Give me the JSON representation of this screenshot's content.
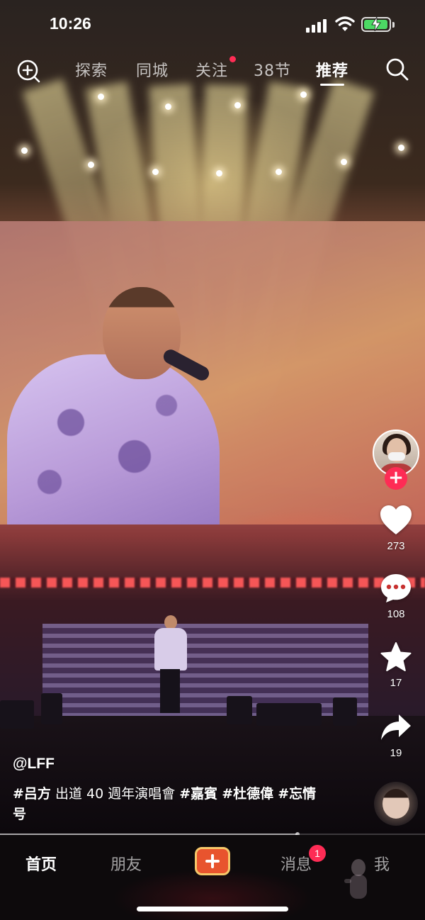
{
  "status_bar": {
    "time": "10:26",
    "battery_color": "#4cd964"
  },
  "top_nav": {
    "tabs": [
      {
        "label": "探索",
        "active": false
      },
      {
        "label": "同城",
        "active": false
      },
      {
        "label": "关注",
        "active": false,
        "has_red_dot": true
      },
      {
        "label": "38节",
        "active": false
      },
      {
        "label": "推荐",
        "active": true
      }
    ],
    "left_icon": "add-circle-search-icon",
    "right_icon": "search-icon"
  },
  "actions": {
    "like_count": "273",
    "comment_count": "108",
    "favorite_count": "17",
    "share_count": "19",
    "follow_label": "+"
  },
  "post": {
    "author": "@LFF",
    "caption_parts": [
      {
        "text": "#吕方",
        "tag": true
      },
      {
        "text": " 出道 40 週年演唱會 ",
        "tag": false
      },
      {
        "text": "#嘉賓",
        "tag": true
      },
      {
        "text": " ",
        "tag": false
      },
      {
        "text": "#杜德偉",
        "tag": true
      },
      {
        "text": " ",
        "tag": false
      },
      {
        "text": "#忘情号",
        "tag": true
      }
    ],
    "progress_fraction": 0.7
  },
  "bottom_bar": {
    "home": "首页",
    "friends": "朋友",
    "messages": "消息",
    "messages_badge": "1",
    "me": "我",
    "create_icon": "plus-icon",
    "accent": "#fe2c55",
    "create_color": "#e8542e"
  }
}
